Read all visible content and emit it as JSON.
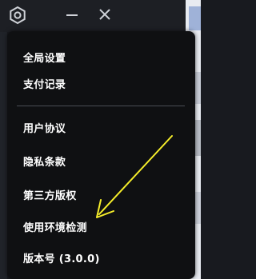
{
  "menu": {
    "groups": [
      {
        "items": [
          {
            "label": "全局设置"
          },
          {
            "label": "支付记录"
          }
        ]
      },
      {
        "items": [
          {
            "label": "用户协议"
          },
          {
            "label": "隐私条款"
          },
          {
            "label": "第三方版权"
          },
          {
            "label": "使用环境检测"
          },
          {
            "label": "版本号 (3.0.0)"
          }
        ]
      }
    ]
  },
  "colors": {
    "menu_bg": "#0f1012",
    "text": "#ffffff",
    "annotation_arrow": "#f6ee2a"
  },
  "icons": {
    "titlebar": [
      "gear-icon",
      "minimize-icon",
      "close-icon"
    ]
  }
}
